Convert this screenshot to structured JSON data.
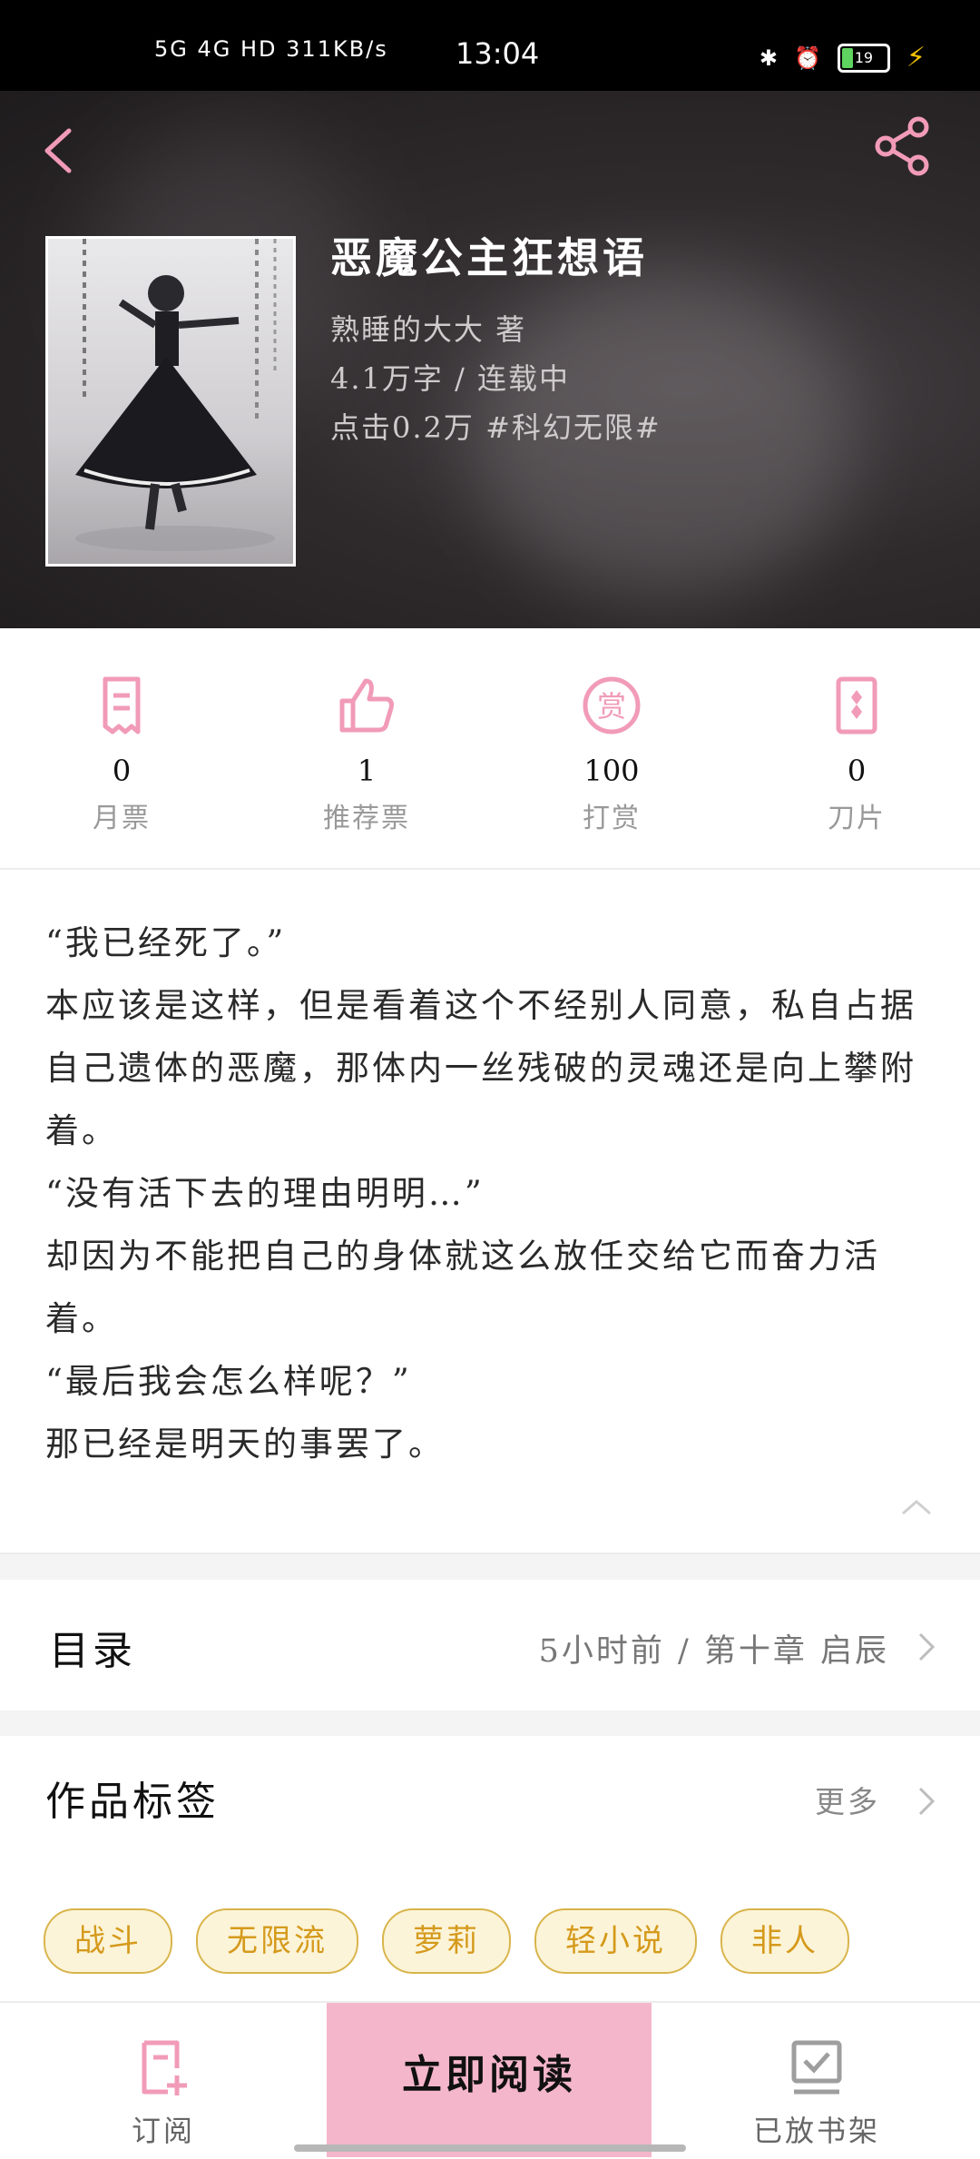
{
  "status_bar": {
    "network": "5G  4G  HD 311KB/s",
    "time": "13:04",
    "battery": "19"
  },
  "book": {
    "title": "恶魔公主狂想语",
    "author": "熟睡的大大  著",
    "words_status": "4.1万字 / 连载中",
    "clicks_tags": "点击0.2万  #科幻无限#"
  },
  "stats": [
    {
      "value": "0",
      "label": "月票",
      "icon": "ticket-icon"
    },
    {
      "value": "1",
      "label": "推荐票",
      "icon": "thumbs-up-icon"
    },
    {
      "value": "100",
      "label": "打赏",
      "icon": "reward-icon"
    },
    {
      "value": "0",
      "label": "刀片",
      "icon": "blade-icon"
    }
  ],
  "intro": [
    "“我已经死了。”",
    "本应该是这样，但是看着这个不经别人同意，私自占据自己遗体的恶魔，那体内一丝残破的灵魂还是向上攀附着。",
    "“没有活下去的理由明明…”",
    "却因为不能把自己的身体就这么放任交给它而奋力活着。",
    "“最后我会怎么样呢？”",
    "那已经是明天的事罢了。"
  ],
  "toc": {
    "title": "目录",
    "latest": "5小时前 / 第十章 启辰"
  },
  "tags": {
    "title": "作品标签",
    "more": "更多",
    "items": [
      "战斗",
      "无限流",
      "萝莉",
      "轻小说",
      "非人"
    ]
  },
  "bottom": {
    "subscribe": "订阅",
    "read": "立即阅读",
    "shelf": "已放书架"
  },
  "colors": {
    "accent": "#f4b6cb",
    "icon_pink": "#f19bb8",
    "tag_border": "#d8b44b",
    "tag_bg": "#fcf4d8",
    "tag_text": "#d59a1c"
  }
}
